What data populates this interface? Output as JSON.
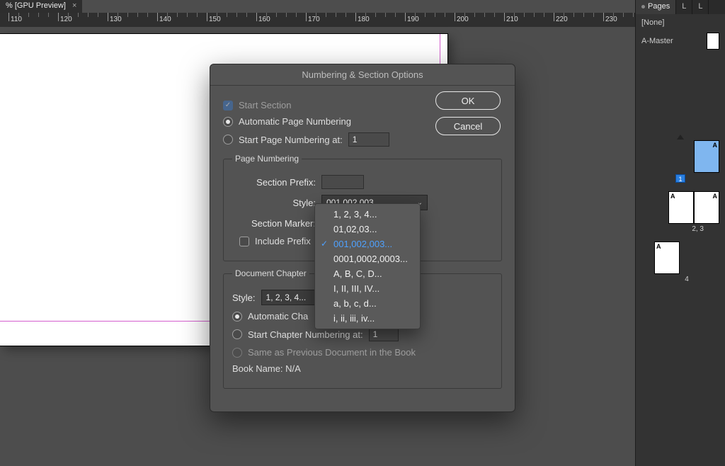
{
  "doc_tab": {
    "label": "% [GPU Preview]"
  },
  "ruler": {
    "start": 110,
    "end": 230,
    "step": 10,
    "labels": [
      "110",
      "120",
      "130",
      "140",
      "150",
      "160",
      "170",
      "180",
      "190",
      "200",
      "210",
      "220",
      "230"
    ]
  },
  "right_panel": {
    "tabs": [
      "Pages",
      "L",
      "L"
    ],
    "active_tab": 0,
    "none_label": "[None]",
    "a_master_label": "A-Master",
    "spreads": {
      "page1_badge": "1",
      "label_23": "2, 3",
      "label_4": "4",
      "a_letter": "A"
    }
  },
  "dialog": {
    "title": "Numbering & Section Options",
    "ok": "OK",
    "cancel": "Cancel",
    "start_section": "Start Section",
    "auto_page_numbering": "Automatic Page Numbering",
    "start_page_numbering_at": "Start Page Numbering at:",
    "start_page_value": "1",
    "page_numbering_legend": "Page Numbering",
    "section_prefix": "Section Prefix:",
    "section_prefix_value": "",
    "style_label": "Style:",
    "style_value": "001,002,003...",
    "section_marker": "Section Marker:",
    "section_marker_value": "",
    "include_prefix": "Include Prefix",
    "doc_chapter_legend": "Document Chapter",
    "chapter_style_label": "Style:",
    "chapter_style_value": "1, 2, 3, 4...",
    "auto_chapter": "Automatic Cha",
    "start_chapter_at": "Start Chapter Numbering at:",
    "start_chapter_value": "1",
    "same_as_prev": "Same as Previous Document in the Book",
    "book_name": "Book Name: N/A",
    "dropdown_options": [
      "1, 2, 3, 4...",
      "01,02,03...",
      "001,002,003...",
      "0001,0002,0003...",
      "A, B, C, D...",
      "I, II, III, IV...",
      "a, b, c, d...",
      "i, ii, iii, iv..."
    ],
    "dropdown_selected_index": 2
  }
}
